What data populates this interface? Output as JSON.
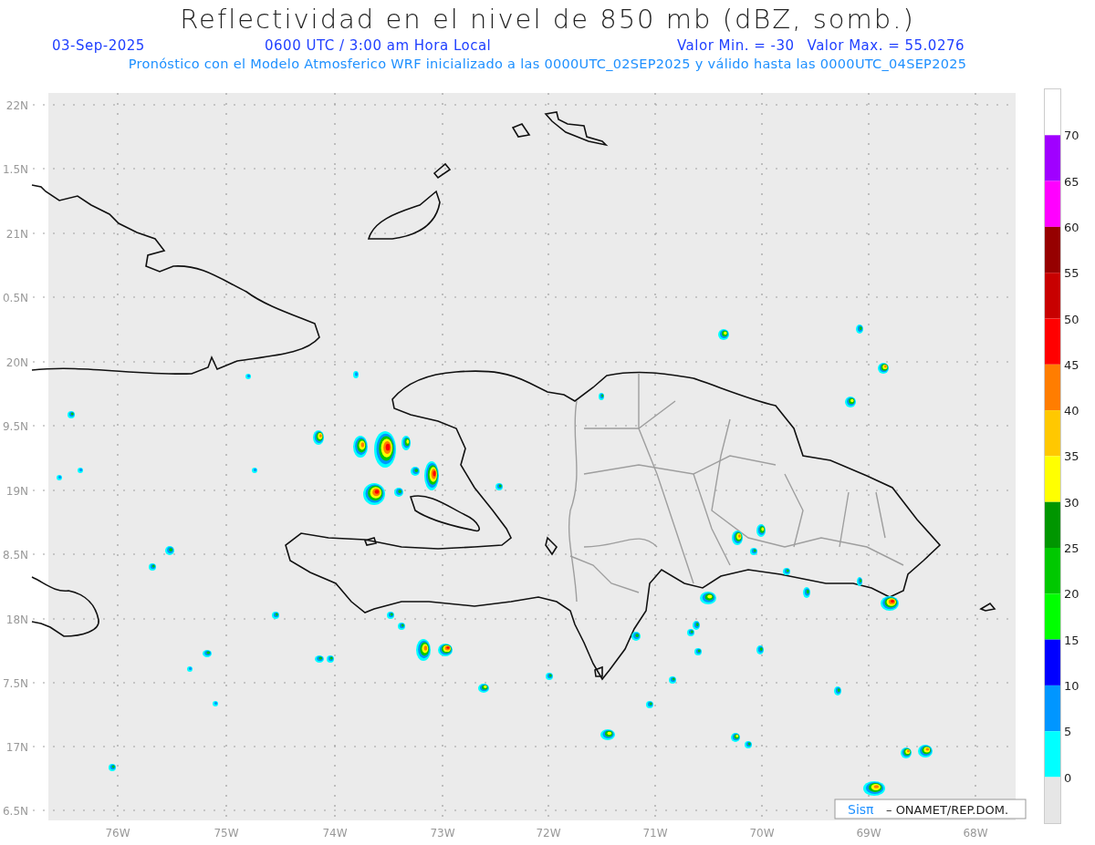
{
  "title": "Reflectividad en el nivel de 850 mb (dBZ, somb.)",
  "info": {
    "date": "03-Sep-2025",
    "time": "0600 UTC / 3:00 am Hora Local",
    "min_value": "Valor Min. = -30",
    "max_value": "Valor Max. = 55.0276"
  },
  "subtitle": "Pronóstico con el Modelo Atmosferico WRF inicializado a las 0000UTC_02SEP2025 y válido hasta las  0000UTC_04SEP2025",
  "map": {
    "y_axis_labels": [
      "22N",
      "1.5N",
      "21N",
      "0.5N",
      "20N",
      "9.5N",
      "19N",
      "8.5N",
      "18N",
      "7.5N",
      "17N",
      "6.5N"
    ],
    "x_axis_labels": [
      "76W",
      "75W",
      "74W",
      "73W",
      "72W",
      "71W",
      "70W",
      "69W",
      "68W"
    ],
    "credit": {
      "logo": "Sisπ",
      "text": "– ONAMET/REP.DOM."
    }
  },
  "colorbar": {
    "segments": [
      {
        "color": "#a000ff",
        "label": "70"
      },
      {
        "color": "#ff00ff",
        "label": "65"
      },
      {
        "color": "#960000",
        "label": "60"
      },
      {
        "color": "#c80000",
        "label": "55"
      },
      {
        "color": "#ff0000",
        "label": "50"
      },
      {
        "color": "#ff7d00",
        "label": "45"
      },
      {
        "color": "#ffc800",
        "label": "40"
      },
      {
        "color": "#ffff00",
        "label": "35"
      },
      {
        "color": "#009600",
        "label": "30"
      },
      {
        "color": "#00c800",
        "label": "25"
      },
      {
        "color": "#00ff00",
        "label": "20"
      },
      {
        "color": "#0000ff",
        "label": "15"
      },
      {
        "color": "#0096ff",
        "label": "10"
      },
      {
        "color": "#00ffff",
        "label": "5"
      },
      {
        "color": "#e6e6e6",
        "label": "0"
      }
    ]
  }
}
